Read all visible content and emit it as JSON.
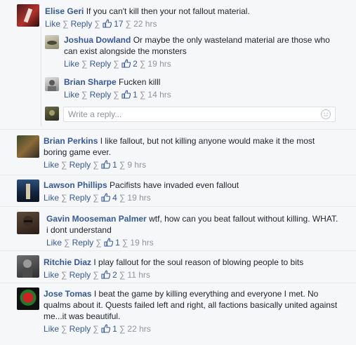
{
  "colors": {
    "link": "#365899",
    "meta": "#90949c",
    "text": "#1d2129",
    "bg": "#f6f7f9"
  },
  "icons": {
    "like": "thumbs-up-icon",
    "emoji": "smiley-icon"
  },
  "actions": {
    "like": "Like",
    "reply": "Reply",
    "sep": "∑"
  },
  "comments": [
    {
      "name": "Elise Geri",
      "text": "If you can't kill then your not fallout material.",
      "likes": "17",
      "time": "22 hrs"
    },
    {
      "name": "Joshua Dowland",
      "text": "Or maybe the only wasteland material are those who can exist alongside the monsters",
      "likes": "2",
      "time": "19 hrs"
    },
    {
      "name": "Brian Sharpe",
      "text": "Fucken killl",
      "likes": "1",
      "time": "14 hrs"
    },
    {
      "name": "Brian Perkins",
      "text": "I like fallout, but not killing anyone would make it the most boring game ever.",
      "likes": "1",
      "time": "9 hrs"
    },
    {
      "name": "Lawson Phillips",
      "text": "Pacifists have invaded even fallout",
      "likes": "4",
      "time": "19 hrs"
    },
    {
      "name": "Gavin Mooseman Palmer",
      "text": "wtf, how can you beat fallout without killing. WHAT. i dont understand",
      "likes": "1",
      "time": "19 hrs"
    },
    {
      "name": "Ritchie Diaz",
      "text": "I play fallout for the soul reason of blowing people to bits",
      "likes": "2",
      "time": "11 hrs"
    },
    {
      "name": "Jose Tomas",
      "text": "I beat the game by killing everything and everyone I met. No qualms about it. Quests failed left and right, all factions basically united against me...it was beautiful.",
      "likes": "1",
      "time": "22 hrs"
    }
  ],
  "reply_box": {
    "placeholder": "Write a reply..."
  }
}
